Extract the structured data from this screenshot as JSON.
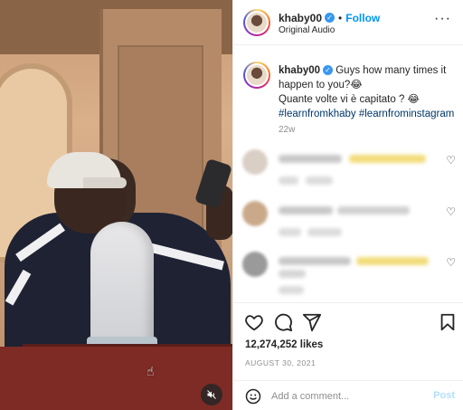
{
  "post": {
    "username": "khaby00",
    "follow_label": "Follow",
    "audio": "Original Audio",
    "more_icon": "more-horizontal-icon",
    "caption_user": "khaby00",
    "caption_text": "Guys how many times it happen to you?😂",
    "caption_text_it": "Quante volte vi è capitato ? 😂",
    "hashtags": "#learnfromkhaby #learnfrominstagram",
    "caption_time": "22w",
    "likes": "12,274,252 likes",
    "date": "AUGUST 30, 2021",
    "comment_placeholder": "Add a comment...",
    "post_label": "Post"
  },
  "colors": {
    "accent": "#0095f6",
    "verified": "#3897f0",
    "hashtag": "#00376b",
    "muted": "#8e8e8e",
    "post_disabled": "#b2dffc"
  }
}
